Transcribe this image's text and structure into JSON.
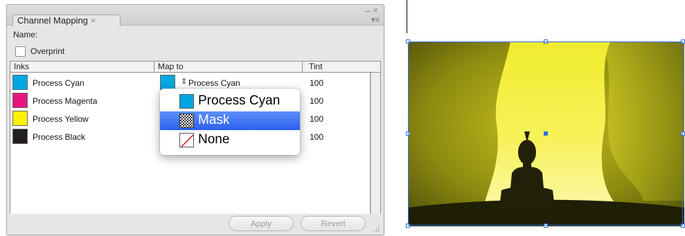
{
  "panel": {
    "tab_title": "Channel Mapping",
    "tab_close_glyph": "×",
    "minimize_glyph": "–",
    "close_glyph": "×",
    "menu_glyph": "▾≡",
    "name_label": "Name:",
    "overprint_label": "Overprint",
    "overprint_checked": false
  },
  "table": {
    "columns": [
      "Inks",
      "Map to",
      "Tint"
    ],
    "rows": [
      {
        "ink": "Process Cyan",
        "ink_color": "#00a7e1",
        "map_to": "Process Cyan",
        "map_color": "#00a7e1",
        "tint": "100"
      },
      {
        "ink": "Process Magenta",
        "ink_color": "#e6157f",
        "map_to": "",
        "map_color": "",
        "tint": "100"
      },
      {
        "ink": "Process Yellow",
        "ink_color": "#fff200",
        "map_to": "",
        "map_color": "",
        "tint": "100"
      },
      {
        "ink": "Process Black",
        "ink_color": "#231f20",
        "map_to": "",
        "map_color": "",
        "tint": "100"
      }
    ],
    "map_arrows_glyph": "⇕"
  },
  "dropdown": {
    "options": [
      {
        "label": "Process Cyan",
        "icon": "cyan-swatch-icon",
        "selected": false
      },
      {
        "label": "Mask",
        "icon": "checkerboard-mask-icon",
        "selected": true
      },
      {
        "label": "None",
        "icon": "none-slash-icon",
        "selected": false
      }
    ]
  },
  "buttons": {
    "apply": "Apply",
    "revert": "Revert"
  },
  "colors": {
    "selection_blue": "#3a6cf4",
    "frame_handle_blue": "#2f6fe0"
  }
}
